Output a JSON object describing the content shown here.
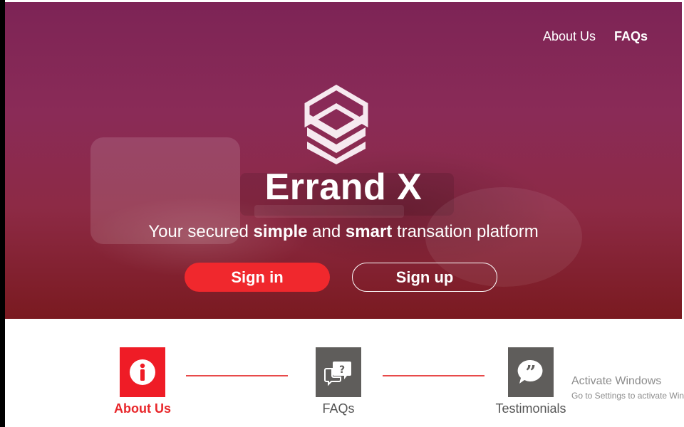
{
  "nav": {
    "about_label": "About Us",
    "faqs_label": "FAQs"
  },
  "hero": {
    "logo_icon": "stacked-chevron-logo-icon",
    "title": "Errand X",
    "tagline": {
      "pre": "Your secured ",
      "bold1": "simple",
      "mid": " and ",
      "bold2": "smart",
      "post": " transation platform"
    },
    "signin_label": "Sign in",
    "signup_label": "Sign up"
  },
  "steps": [
    {
      "label": "About Us",
      "icon": "info-icon",
      "active": true
    },
    {
      "label": "FAQs",
      "icon": "question-chat-icon",
      "active": false
    },
    {
      "label": "Testimonials",
      "icon": "quote-bubble-icon",
      "active": false
    }
  ],
  "watermark": {
    "line1": "Activate Windows",
    "line2": "Go to Settings to activate Windows."
  },
  "colors": {
    "accent": "#ef1c26",
    "hero_overlay": "#8a2b57",
    "step_inactive": "#5f5d5b"
  }
}
